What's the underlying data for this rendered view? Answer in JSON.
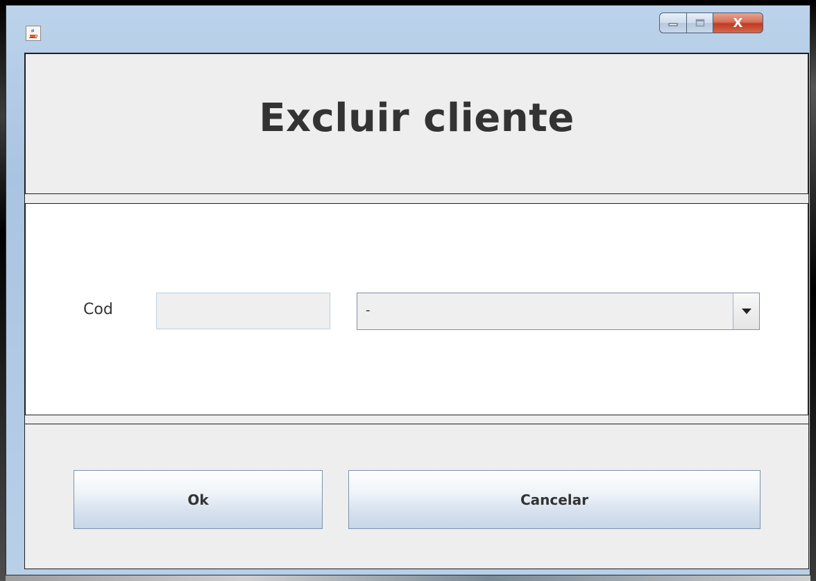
{
  "window": {
    "title": "",
    "icon": "java-cup-icon",
    "controls": {
      "minimize_icon": "minimize-icon",
      "maximize_icon": "maximize-icon",
      "close_label": "X"
    }
  },
  "header": {
    "title": "Excluir cliente"
  },
  "form": {
    "cod_label": "Cod",
    "cod_value": "",
    "cliente_select_value": "-"
  },
  "actions": {
    "ok_label": "Ok",
    "cancel_label": "Cancelar"
  },
  "colors": {
    "title_text": "#333333",
    "panel_bg": "#eeeeee",
    "form_bg": "#ffffff",
    "close_button": "#c03a20"
  }
}
